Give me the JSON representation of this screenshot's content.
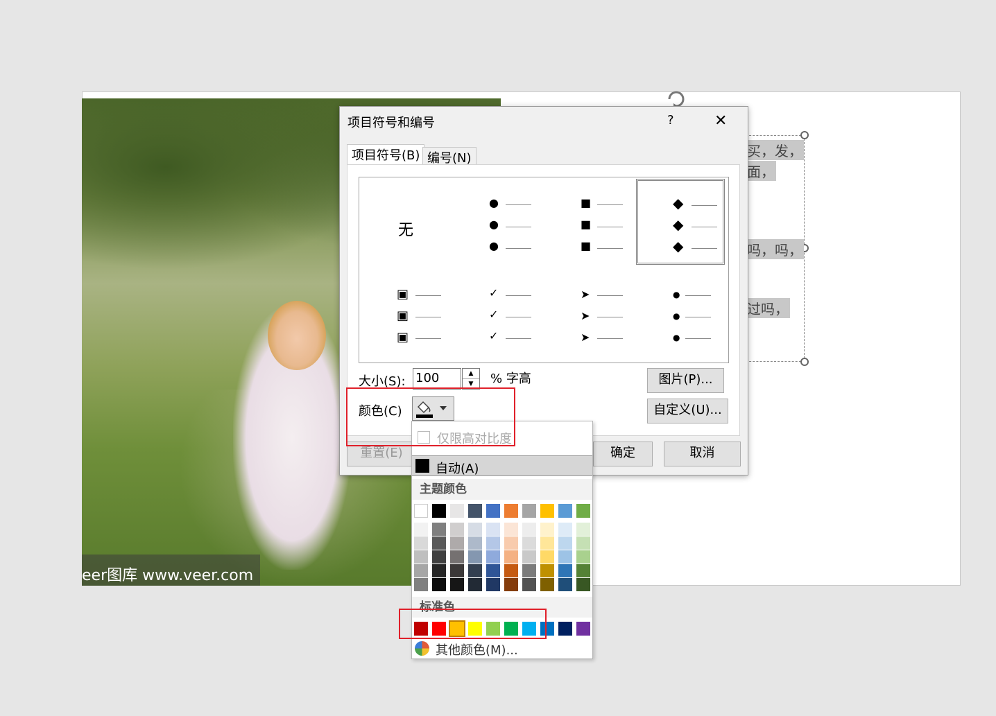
{
  "dialog": {
    "title": "项目符号和编号",
    "help": "?",
    "close": "✕",
    "tabs": [
      "项目符号(B)",
      "编号(N)"
    ],
    "gallery": {
      "none_label": "无",
      "styles": [
        "none",
        "filled-round",
        "filled-square",
        "diamond",
        "hollow-square",
        "checkmark",
        "arrow",
        "small-dot"
      ],
      "selected": "diamond"
    },
    "size_label": "大小(S):",
    "size_value": "100",
    "size_unit": "% 字高",
    "color_label": "颜色(C)",
    "picture_button": "图片(P)...",
    "custom_button": "自定义(U)...",
    "reset_button": "重置(E)",
    "ok_button": "确定",
    "cancel_button": "取消"
  },
  "color_menu": {
    "high_contrast_label": "仅限高对比度",
    "auto_label": "自动(A)",
    "theme_header": "主题颜色",
    "theme_colors": [
      "#ffffff",
      "#000000",
      "#e7e6e6",
      "#44546a",
      "#4472c4",
      "#ed7d31",
      "#a5a5a5",
      "#ffc000",
      "#5b9bd5",
      "#70ad47"
    ],
    "theme_tints": [
      [
        "#f2f2f2",
        "#d9d9d9",
        "#bfbfbf",
        "#a6a6a6",
        "#808080"
      ],
      [
        "#7f7f7f",
        "#595959",
        "#404040",
        "#262626",
        "#0d0d0d"
      ],
      [
        "#d0cece",
        "#aeaaaa",
        "#757171",
        "#3b3838",
        "#161616"
      ],
      [
        "#d6dce5",
        "#adb9ca",
        "#8497b0",
        "#333f50",
        "#222a35"
      ],
      [
        "#dae3f3",
        "#b4c7e7",
        "#8faadc",
        "#2f5597",
        "#203864"
      ],
      [
        "#fbe5d6",
        "#f8cbad",
        "#f4b183",
        "#c55a11",
        "#843c0c"
      ],
      [
        "#ededed",
        "#dbdbdb",
        "#c9c9c9",
        "#7b7b7b",
        "#525252"
      ],
      [
        "#fff2cc",
        "#ffe699",
        "#ffd966",
        "#bf9000",
        "#7f6000"
      ],
      [
        "#deebf7",
        "#bdd7ee",
        "#9dc3e6",
        "#2e75b6",
        "#1f4e79"
      ],
      [
        "#e2f0d9",
        "#c5e0b4",
        "#a9d18e",
        "#548235",
        "#385723"
      ]
    ],
    "standard_header": "标准色",
    "standard_colors": [
      "#c00000",
      "#ff0000",
      "#ffc000",
      "#ffff00",
      "#92d050",
      "#00b050",
      "#00b0f0",
      "#0070c0",
      "#002060",
      "#7030a0"
    ],
    "more_colors": "其他颜色(M)..."
  },
  "slide": {
    "watermark": "eer图库 www.veer.com",
    "text_fragments": [
      "买，发，",
      "面，",
      "吗，吗，",
      "过吗，"
    ]
  }
}
